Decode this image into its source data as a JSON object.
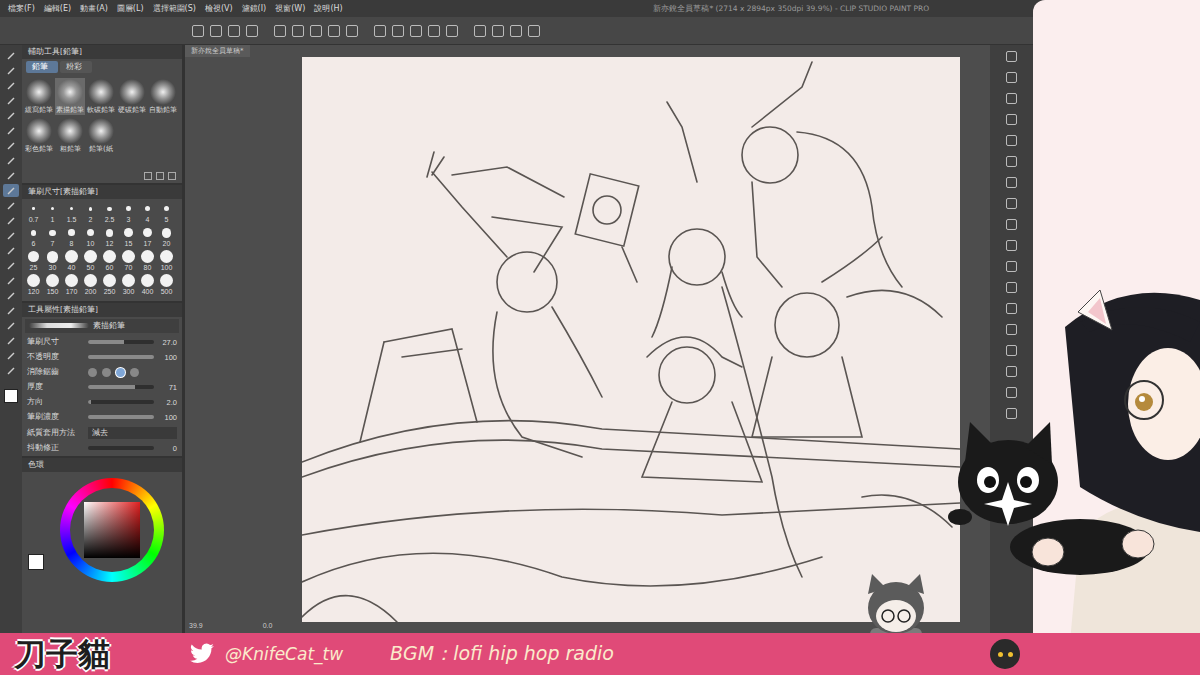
{
  "window": {
    "title": "新亦銳全員草稿* (2714 x 2894px 350dpi 39.9%) - CLIP STUDIO PAINT PRO"
  },
  "menu": [
    "檔案(F)",
    "編輯(E)",
    "動畫(A)",
    "圖層(L)",
    "選擇範圍(S)",
    "檢視(V)",
    "濾鏡(I)",
    "視窗(W)",
    "說明(H)"
  ],
  "tools": [
    {
      "selected": false
    },
    {
      "selected": false
    },
    {
      "selected": false
    },
    {
      "selected": false
    },
    {
      "selected": false
    },
    {
      "selected": false
    },
    {
      "selected": false
    },
    {
      "selected": false
    },
    {
      "selected": false
    },
    {
      "selected": true
    },
    {
      "selected": false
    },
    {
      "selected": false
    },
    {
      "selected": false
    },
    {
      "selected": false
    },
    {
      "selected": false
    },
    {
      "selected": false
    },
    {
      "selected": false
    },
    {
      "selected": false
    },
    {
      "selected": false
    },
    {
      "selected": false
    },
    {
      "selected": false
    },
    {
      "selected": false
    }
  ],
  "document_tab": {
    "label": "新亦銳全員草稿*"
  },
  "sub_tool": {
    "title": "輔助工具[鉛筆]",
    "groups": [
      {
        "label": "鉛筆",
        "selected": true
      },
      {
        "label": "粉彩",
        "selected": false
      }
    ],
    "brushes": [
      {
        "label": "緩寫鉛筆",
        "selected": false
      },
      {
        "label": "素描鉛筆",
        "selected": true
      },
      {
        "label": "軟碳鉛筆",
        "selected": false
      },
      {
        "label": "硬碳鉛筆",
        "selected": false
      },
      {
        "label": "自動鉛筆",
        "selected": false
      },
      {
        "label": "彩色鉛筆",
        "selected": false
      },
      {
        "label": "粗鉛筆",
        "selected": false
      },
      {
        "label": "鉛筆(紙",
        "selected": false
      }
    ]
  },
  "brush_size": {
    "title": "筆刷尺寸[素描鉛筆]",
    "sizes": [
      "0.7",
      "1",
      "1.5",
      "2",
      "2.5",
      "3",
      "4",
      "5",
      "6",
      "7",
      "8",
      "10",
      "12",
      "15",
      "17",
      "20",
      "25",
      "30",
      "40",
      "50",
      "60",
      "70",
      "80",
      "100",
      "120",
      "150",
      "170",
      "200",
      "250",
      "300",
      "400",
      "500"
    ]
  },
  "tool_property": {
    "title": "工具屬性[素描鉛筆]",
    "preset": "素描鉛筆",
    "rows": [
      {
        "label": "筆刷尺寸",
        "kind": "slider",
        "value": "27.0",
        "level": 0.55
      },
      {
        "label": "不透明度",
        "kind": "slider",
        "value": "100",
        "level": 1
      },
      {
        "label": "消除鋸齒",
        "kind": "options",
        "choices": [
          {
            "selected": false
          },
          {
            "selected": false
          },
          {
            "selected": true
          },
          {
            "selected": false
          }
        ]
      },
      {
        "label": "厚度",
        "kind": "slider",
        "value": "71",
        "level": 0.71
      },
      {
        "label": "方向",
        "kind": "slider",
        "value": "2.0",
        "level": 0.05
      },
      {
        "label": "筆刷濃度",
        "kind": "slider",
        "value": "100",
        "level": 1
      },
      {
        "label": "紙質套用方法",
        "kind": "select",
        "value": "減去"
      },
      {
        "label": "抖動修正",
        "kind": "slider",
        "value": "0",
        "level": 0
      }
    ]
  },
  "color_panel": {
    "tab": "色環"
  },
  "status": {
    "zoom": "39.9",
    "angle": "0.0"
  },
  "overlay": {
    "logo": "刀子貓",
    "twitter": "@KnifeCat_tw",
    "bgm": "BGM：lofi hip hop radio"
  }
}
